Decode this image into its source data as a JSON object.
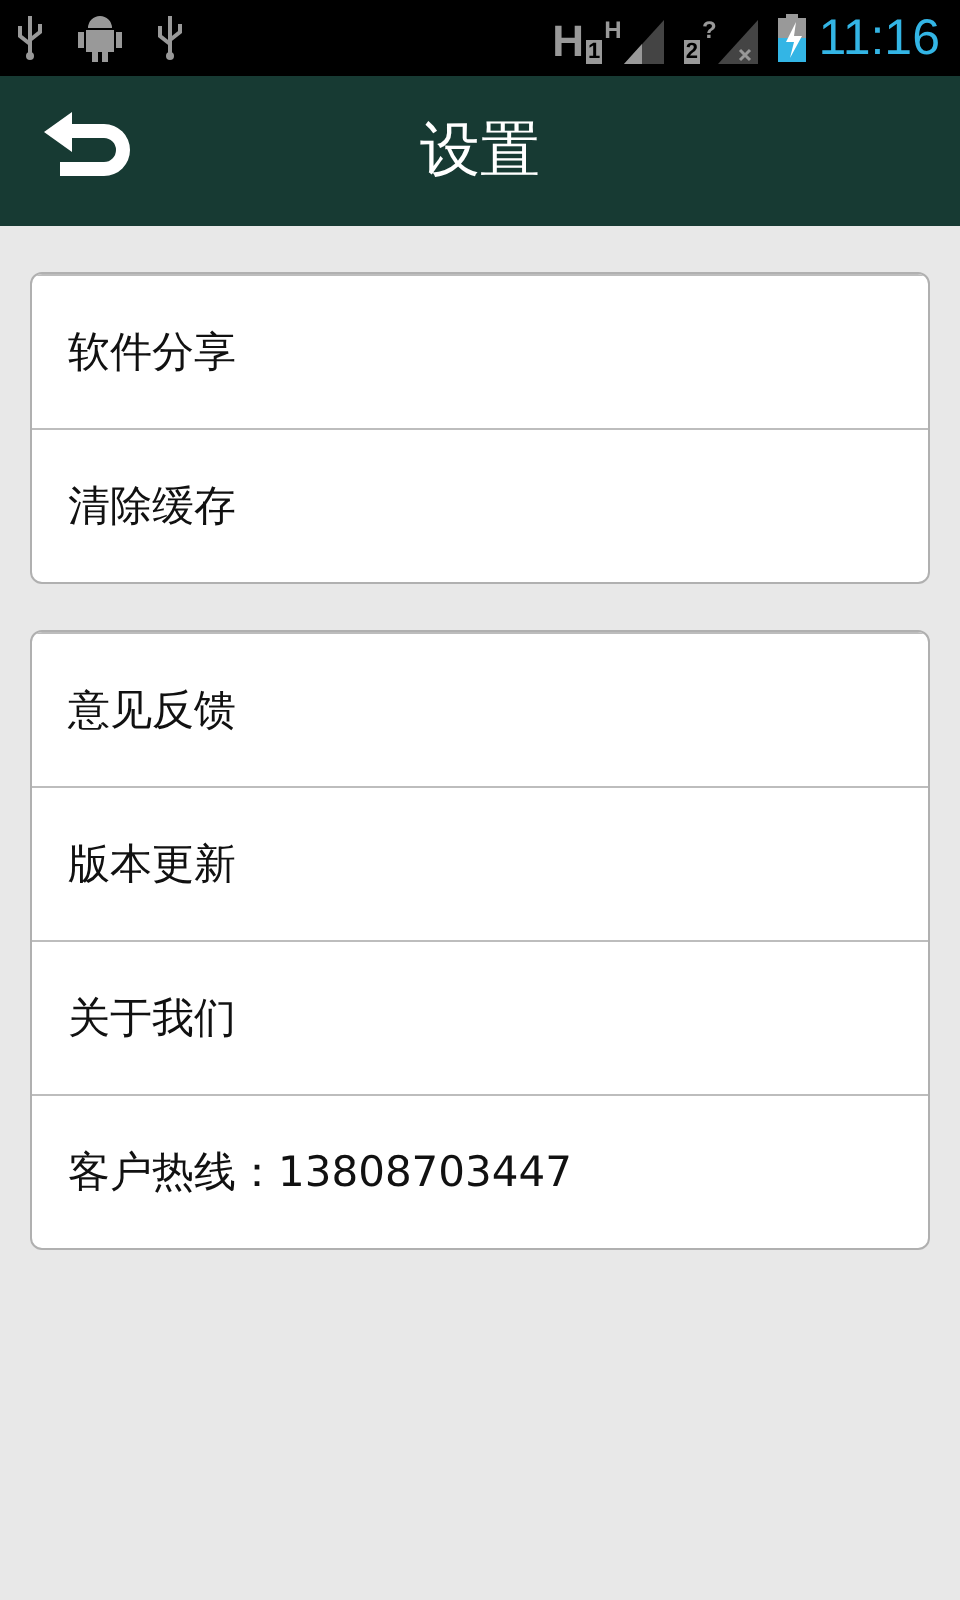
{
  "status_bar": {
    "time": "11:16",
    "sims": [
      {
        "network": "H",
        "slot": "1",
        "badge": "H",
        "no_signal": false
      },
      {
        "slot": "2",
        "badge": "?",
        "no_signal": true
      }
    ]
  },
  "header": {
    "title": "设置"
  },
  "groups": [
    {
      "items": [
        "软件分享",
        "清除缓存"
      ]
    },
    {
      "items": [
        "意见反馈",
        "版本更新",
        "关于我们",
        "客户热线：13808703447"
      ]
    }
  ]
}
